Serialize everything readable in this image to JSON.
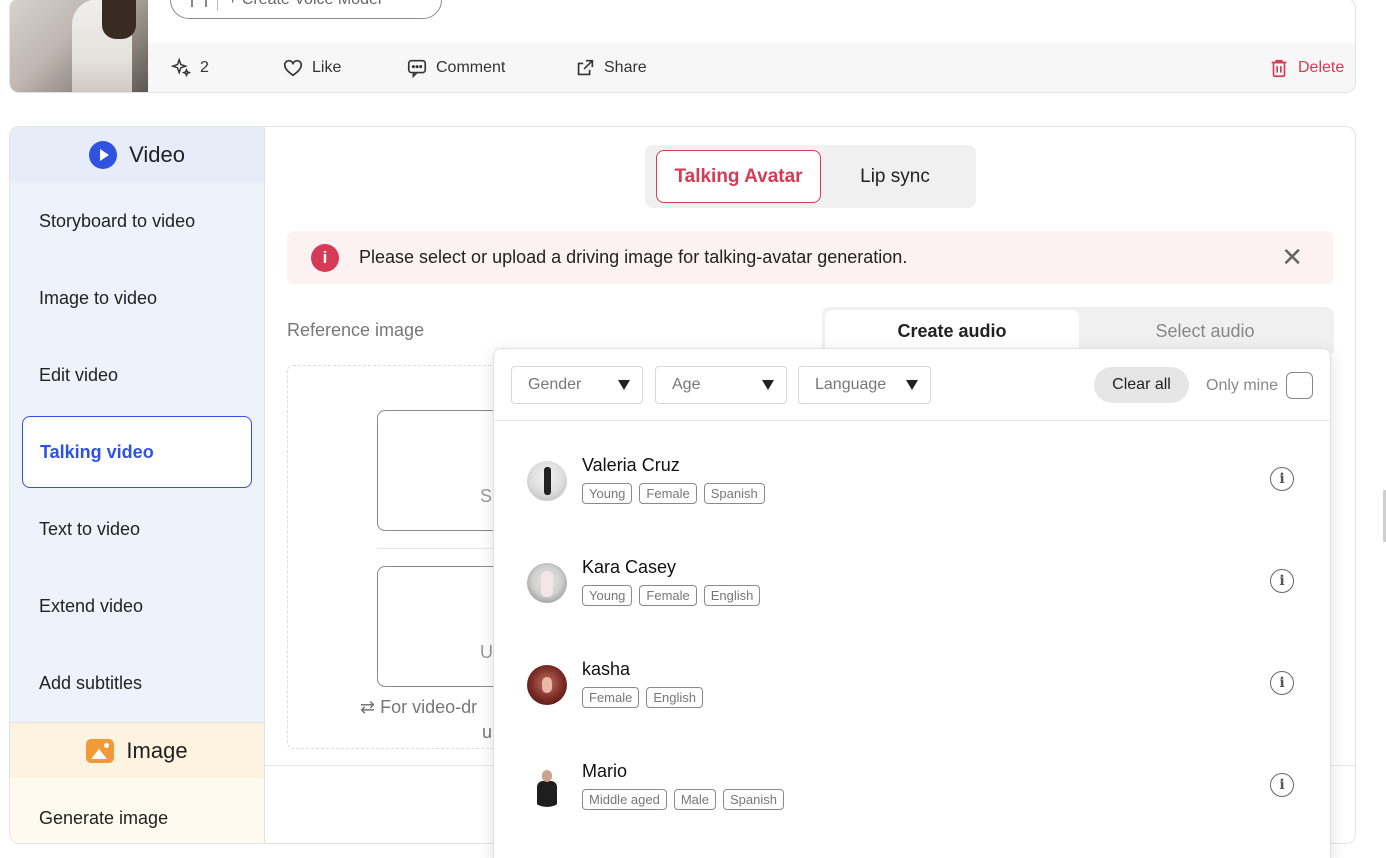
{
  "post": {
    "voice_model_label": "+ Create Voice Model",
    "generations_count": "2",
    "like_label": "Like",
    "comment_label": "Comment",
    "share_label": "Share",
    "delete_label": "Delete"
  },
  "sidebar": {
    "video_heading": "Video",
    "items": [
      {
        "label": "Storyboard to video"
      },
      {
        "label": "Image to video"
      },
      {
        "label": "Edit video"
      },
      {
        "label": "Talking video"
      },
      {
        "label": "Text to video"
      },
      {
        "label": "Extend video"
      },
      {
        "label": "Add subtitles"
      }
    ],
    "image_heading": "Image",
    "image_items": [
      {
        "label": "Generate image"
      }
    ]
  },
  "mode_toggle": {
    "active": "Talking Avatar",
    "inactive": "Lip sync"
  },
  "alert": {
    "message": "Please select or upload a driving image for talking-avatar generation.",
    "close_glyph": "✕"
  },
  "reference": {
    "label": "Reference image",
    "card1_char": "S",
    "card2_char": "U",
    "hint": "⇄ For video-dr",
    "hint_line2": "u"
  },
  "audio_tabs": {
    "create": "Create audio",
    "select": "Select audio"
  },
  "filters": {
    "gender": "Gender",
    "age": "Age",
    "language": "Language",
    "clear_all": "Clear all",
    "only_mine": "Only mine"
  },
  "voices": [
    {
      "name": "Valeria Cruz",
      "tags": [
        "Young",
        "Female",
        "Spanish"
      ]
    },
    {
      "name": "Kara Casey",
      "tags": [
        "Young",
        "Female",
        "English"
      ]
    },
    {
      "name": "kasha",
      "tags": [
        "Female",
        "English"
      ]
    },
    {
      "name": "Mario",
      "tags": [
        "Middle aged",
        "Male",
        "Spanish"
      ]
    }
  ]
}
